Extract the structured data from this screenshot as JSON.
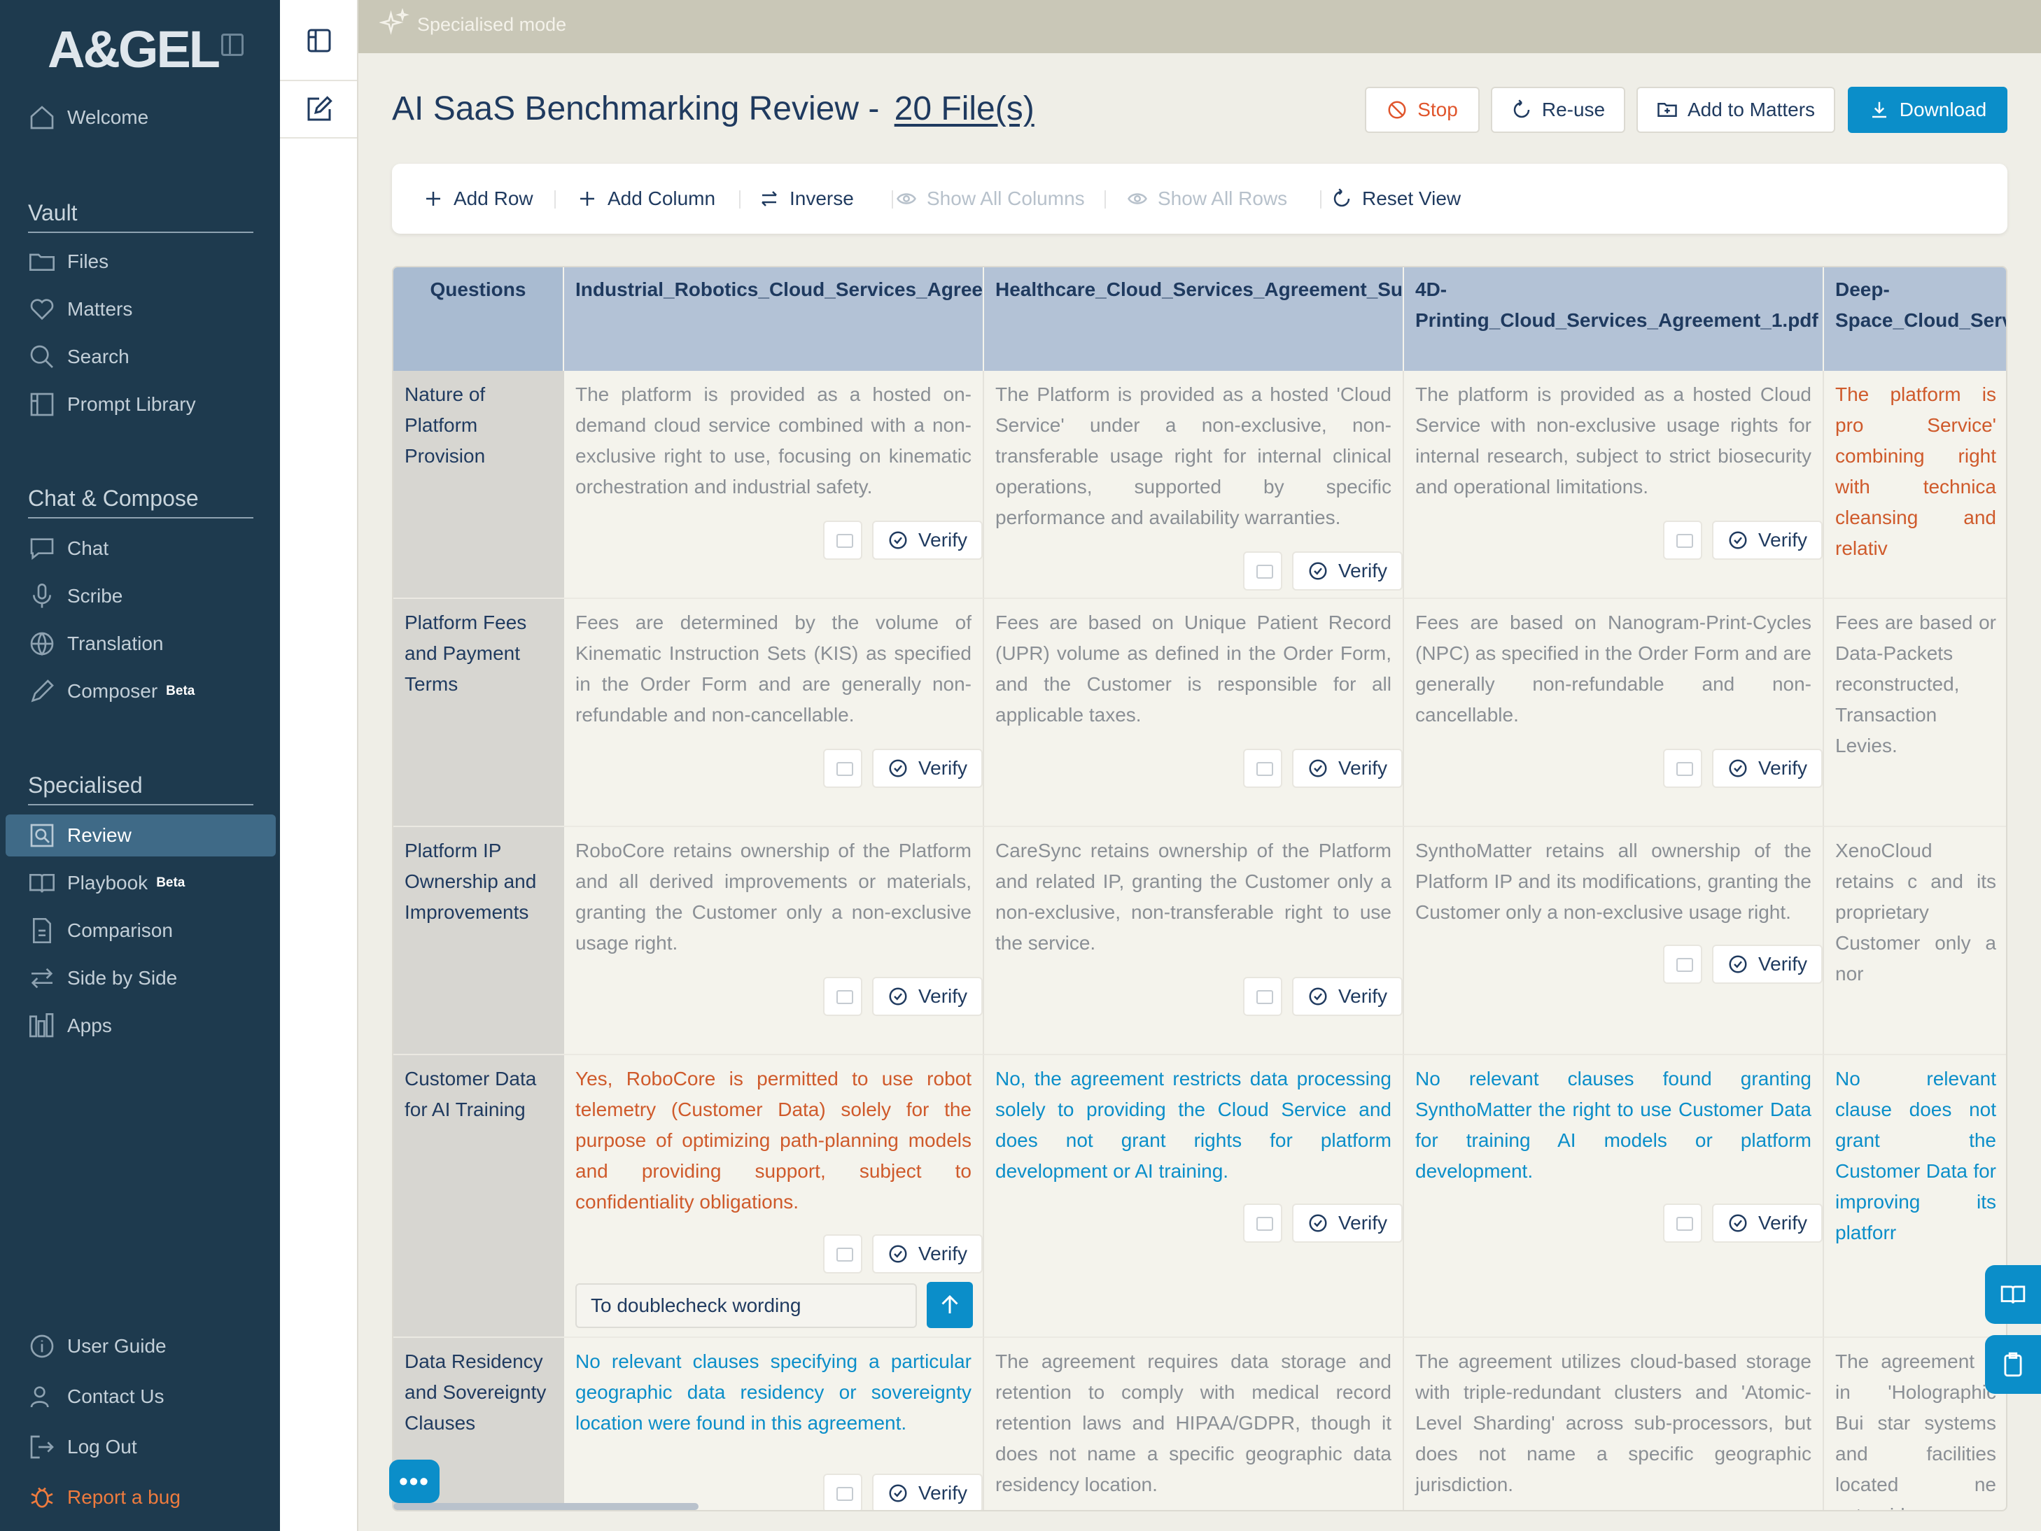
{
  "app": {
    "logo": "A&GEL",
    "mode_label": "Specialised mode"
  },
  "sidebar": {
    "welcome": "Welcome",
    "vault_title": "Vault",
    "vault_items": [
      "Files",
      "Matters",
      "Search",
      "Prompt Library"
    ],
    "chat_title": "Chat & Compose",
    "chat_items": [
      "Chat",
      "Scribe",
      "Translation",
      "Composer"
    ],
    "beta": "Beta",
    "specialised_title": "Specialised",
    "specialised_items": [
      "Review",
      "Playbook",
      "Comparison",
      "Side by Side",
      "Apps"
    ],
    "active_item": "Review",
    "footer_items": [
      "User Guide",
      "Contact Us",
      "Log Out",
      "Report a bug"
    ]
  },
  "header": {
    "title": "AI SaaS Benchmarking Review -",
    "files_link": "20 File(s)",
    "stop": "Stop",
    "reuse": "Re-use",
    "add_to_matters": "Add to Matters",
    "download": "Download"
  },
  "toolbar": {
    "add_row": "Add Row",
    "add_column": "Add Column",
    "inverse": "Inverse",
    "show_all_columns": "Show All Columns",
    "show_all_rows": "Show All Rows",
    "reset_view": "Reset View"
  },
  "grid": {
    "questions_header": "Questions",
    "columns": [
      "Industrial_Robotics_Cloud_Services_Agreement.pdf",
      "Healthcare_Cloud_Services_Agreement_Summary.pdf",
      "4D-Printing_Cloud_Services_Agreement_1.pdf",
      "Deep-Space_Cloud_Serv"
    ],
    "verify_label": "Verify",
    "rows": [
      {
        "question": "Nature of Platform Provision",
        "cells": [
          "The platform is provided as a hosted on-demand cloud service combined with a non-exclusive right to use, focusing on kinematic orchestration and industrial safety.",
          "The Platform is provided as a hosted 'Cloud Service' under a non-exclusive, non-transferable usage right for internal clinical operations, supported by specific performance and availability warranties.",
          "The platform is provided as a hosted Cloud Service with non-exclusive usage rights for internal research, subject to strict biosecurity and operational limitations.",
          "The platform is pro Service' combining right with technica cleansing and relativ"
        ]
      },
      {
        "question": "Platform Fees and Payment Terms",
        "cells": [
          "Fees are determined by the volume of Kinematic Instruction Sets (KIS) as specified in the Order Form and are generally non-refundable and non-cancellable.",
          "Fees are based on Unique Patient Record (UPR) volume as defined in the Order Form, and the Customer is responsible for all applicable taxes.",
          "Fees are based on Nanogram-Print-Cycles (NPC) as specified in the Order Form and are generally non-refundable and non-cancellable.",
          "Fees are based or Data-Packets reconstructed, Transaction Levies."
        ]
      },
      {
        "question": "Platform IP Ownership and Improvements",
        "cells": [
          "RoboCore retains ownership of the Platform and all derived improvements or materials, granting the Customer only a non-exclusive usage right.",
          "CareSync retains ownership of the Platform and related IP, granting the Customer only a non-exclusive, non-transferable right to use the service.",
          "SynthoMatter retains all ownership of the Platform IP and its modifications, granting the Customer only a non-exclusive usage right.",
          "XenoCloud retains c and its proprietary Customer only a nor"
        ]
      },
      {
        "question": "Customer Data for AI Training",
        "cells": [
          "Yes, RoboCore is permitted to use robot telemetry (Customer Data) solely for the purpose of optimizing path-planning models and providing support, subject to confidentiality obligations.",
          "No, the agreement restricts data processing solely to providing the Cloud Service and does not grant rights for platform development or AI training.",
          "No relevant clauses found granting SynthoMatter the right to use Customer Data for training AI models or platform development.",
          "No relevant clause does not grant the Customer Data for improving its platforr"
        ],
        "note": "To doublecheck wording"
      },
      {
        "question": "Data Residency and Sovereignty Clauses",
        "cells": [
          "No relevant clauses specifying a particular geographic data residency or sovereignty location were found in this agreement.",
          "The agreement requires data storage and retention to comply with medical record retention laws and HIPAA/GDPR, though it does not name a specific geographic data residency location.",
          "The agreement utilizes cloud-based storage with triple-redundant clusters and 'Atomic-Level Sharding' across sub-processors, but does not name a specific geographic jurisdiction.",
          "The agreement s in 'Holographic Bui star systems and facilities located ne asteroids."
        ]
      }
    ]
  },
  "colors": {
    "sidebar_bg": "#1e3a4e",
    "accent": "#0b8ec9",
    "orange": "#cf5a2b",
    "header_blue": "#b3c2d6"
  }
}
